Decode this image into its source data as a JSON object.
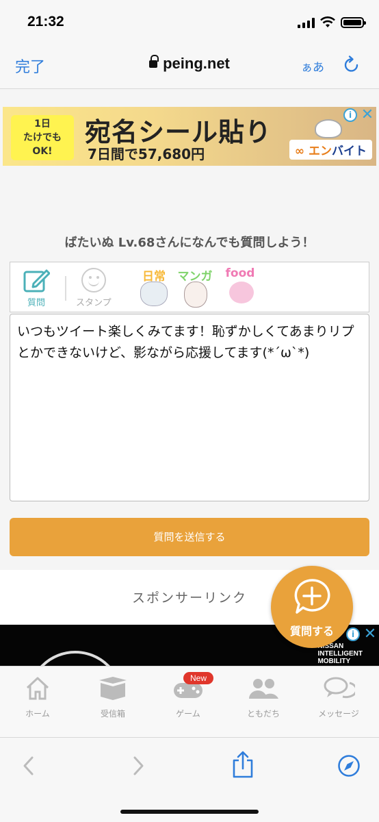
{
  "status_bar": {
    "time": "21:32"
  },
  "browser": {
    "done_label": "完了",
    "url": "peing.net",
    "text_size_label": "ぁあ"
  },
  "ad_banner": {
    "badge_lines": [
      "1日",
      "たけでも",
      "OK!"
    ],
    "title": "宛名シール貼り",
    "subtitle": "7日間で57,680円",
    "logo_prefix": "∞ エン",
    "logo_suffix": "バイト"
  },
  "prompt": "ばたいぬ Lv.68さんになんでも質問しよう！",
  "tools": {
    "question_label": "質問",
    "stamp_label": "スタンプ",
    "stamp_sets": [
      "日常",
      "マンガ",
      "food"
    ]
  },
  "question_text": "いつもツイート楽しくみてます！恥ずかしくてあまりリプとかできないけど、影ながら応援してます(*´ω`*)",
  "submit_label": "質問を送信する",
  "sponsor_label": "スポンサーリンク",
  "black_ad_text": [
    "NISSAN",
    "INTELLIGENT",
    "MOBILITY"
  ],
  "fab_label": "質問する",
  "nav": {
    "items": [
      "ホーム",
      "受信箱",
      "ゲーム",
      "ともだち",
      "メッセージ"
    ],
    "new_badge": "New"
  },
  "colors": {
    "accent": "#e9a23b",
    "link_blue": "#2f7ddb",
    "teal": "#4bb0b8"
  }
}
